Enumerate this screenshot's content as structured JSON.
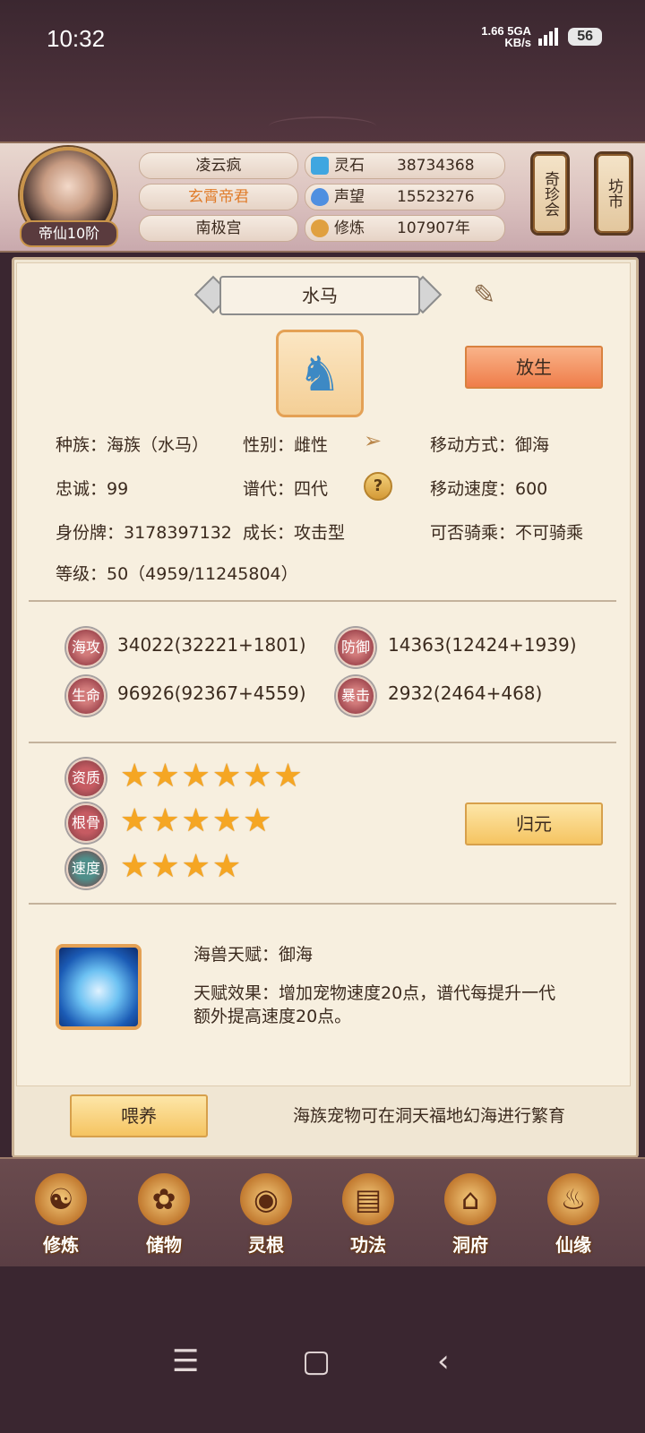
{
  "status_bar": {
    "time": "10:32",
    "net_speed": "1.66",
    "net_unit": "KB/s",
    "network": "5GA",
    "battery": "56"
  },
  "player": {
    "rank": "帝仙10阶",
    "name": "凌云疯",
    "title": "玄霄帝君",
    "sect": "南极宫",
    "title_color": "#e07c2a"
  },
  "resources": [
    {
      "label": "灵石",
      "value": "38734368",
      "icon": "spirit-stone-icon"
    },
    {
      "label": "声望",
      "value": "15523276",
      "icon": "reputation-icon"
    },
    {
      "label": "修炼",
      "value": "107907年",
      "icon": "meditation-icon"
    }
  ],
  "side_buttons": {
    "treasure": "奇珍会",
    "market": "坊市"
  },
  "pet": {
    "name": "水马",
    "release_label": "放生",
    "info": {
      "race": "种族：海族（水马）",
      "gender": "性别：雌性",
      "move_mode": "移动方式：御海",
      "loyalty": "忠诚：99",
      "generation": "谱代：四代",
      "move_speed": "移动速度：600",
      "id_tag": "身份牌：3178397132",
      "growth": "成长：攻击型",
      "rideable": "可否骑乘：不可骑乘",
      "level": "等级：50（4959/11245804）"
    },
    "help_label": "?",
    "stats": [
      {
        "label": "海攻",
        "value": "34022(32221+1801)"
      },
      {
        "label": "防御",
        "value": "14363(12424+1939)"
      },
      {
        "label": "生命",
        "value": "96926(92367+4559)"
      },
      {
        "label": "暴击",
        "value": "2932(2464+468)"
      }
    ],
    "qualities": [
      {
        "label": "资质",
        "stars": 6,
        "stars_text": "★★★★★★",
        "color": "#c65b62"
      },
      {
        "label": "根骨",
        "stars": 5,
        "stars_text": "★★★★★",
        "color": "#c65b62"
      },
      {
        "label": "速度",
        "stars": 4,
        "stars_text": "★★★★",
        "color": "#4f8f8a"
      }
    ],
    "return_label": "归元",
    "talent": {
      "name": "海兽天赋：御海",
      "effect": "天赋效果：增加宠物速度20点，谱代每提升一代额外提高速度20点。"
    }
  },
  "footer": {
    "feed_label": "喂养",
    "hint": "海族宠物可在洞天福地幻海进行繁育"
  },
  "nav": [
    {
      "label": "修炼",
      "icon": "monk-icon",
      "glyph": "☯"
    },
    {
      "label": "储物",
      "icon": "bag-icon",
      "glyph": "✿"
    },
    {
      "label": "灵根",
      "icon": "spirit-root-icon",
      "glyph": "◉"
    },
    {
      "label": "功法",
      "icon": "book-icon",
      "glyph": "▤"
    },
    {
      "label": "洞府",
      "icon": "palace-icon",
      "glyph": "⌂"
    },
    {
      "label": "仙缘",
      "icon": "gourd-icon",
      "glyph": "♨"
    }
  ]
}
